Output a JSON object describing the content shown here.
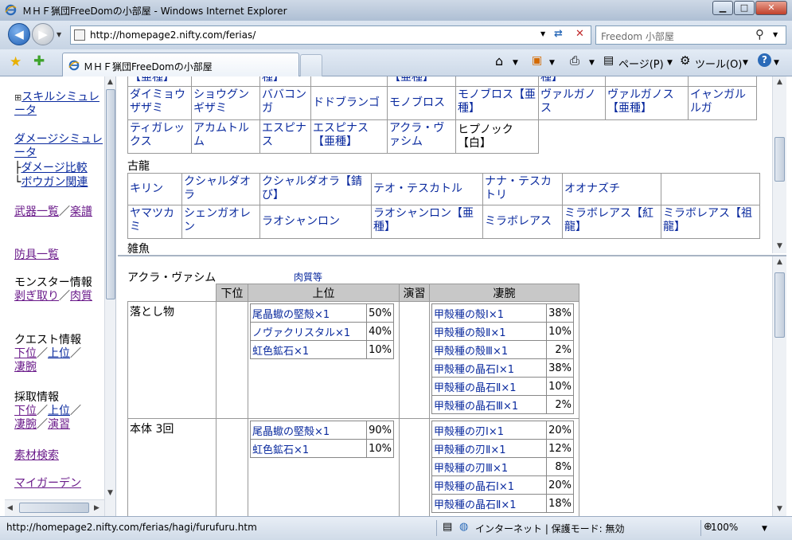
{
  "window": {
    "title": "ＭＨＦ猟団FreeDomの小部屋 - Windows Internet Explorer"
  },
  "nav": {
    "url": "http://homepage2.nifty.com/ferias/",
    "search_placeholder": "Freedom 小部屋"
  },
  "tab": {
    "title": "ＭＨＦ猟団FreeDomの小部屋"
  },
  "toolbar": {
    "page_label": "ページ(P)",
    "tools_label": "ツール(O)"
  },
  "status": {
    "url": "http://homepage2.nifty.com/ferias/hagi/furufuru.htm",
    "zone": "インターネット | 保護モード: 無効",
    "zoom": "100%"
  },
  "sidebar": {
    "skill_sim": "スキルシミュレータ",
    "damage_sim": "ダメージシミュレータ",
    "damage_compare": "ダメージ比較",
    "bowgun": "ボウガン関連",
    "weapons": "武器一覧",
    "score": "楽譜",
    "armor": "防具一覧",
    "monster_info": "モンスター情報",
    "hagitori": "剥ぎ取り",
    "meat": "肉質",
    "quest_info": "クエスト情報",
    "lower": "下位",
    "upper": "上位",
    "sugo": "凄腕",
    "gather_info": "採取情報",
    "practice": "演習",
    "material_search": "素材検索",
    "my_garden": "マイガーデン"
  },
  "monsters": {
    "row_partial": [
      "【亜種】",
      "",
      "種】",
      "",
      "【亜種】",
      "",
      "種】",
      ""
    ],
    "row1": [
      "ダイミョウザザミ",
      "ショウグンギザミ",
      "ババコンガ",
      "ドドブランゴ",
      "モノブロス",
      "モノブロス【亜種】",
      "ヴァルガノス",
      "ヴァルガノス【亜種】",
      "イャンガルルガ"
    ],
    "row2": [
      "ティガレックス",
      "アカムトルム",
      "エスピナス",
      "エスピナス【亜種】",
      "アクラ・ヴァシム",
      "ヒプノック【白】"
    ],
    "elder_label": "古龍",
    "elder_row1": [
      "キリン",
      "クシャルダオラ",
      "クシャルダオラ【錆び】",
      "テオ・テスカトル",
      "ナナ・テスカトリ",
      "オオナズチ"
    ],
    "elder_row2": [
      "ヤマツカミ",
      "シェンガオレン",
      "ラオシャンロン",
      "ラオシャンロン【亜種】",
      "ミラボレアス",
      "ミラボレアス【紅龍】",
      "ミラボレアス【祖龍】"
    ],
    "misc_label": "雑魚"
  },
  "detail": {
    "monster_name": "アクラ・ヴァシム",
    "meat_link": "肉質等",
    "headers": [
      "",
      "下位",
      "上位",
      "演習",
      "凄腕"
    ],
    "drops": {
      "label": "落とし物",
      "upper": [
        {
          "item": "尾晶蠍の堅殻×1",
          "pct": "50%"
        },
        {
          "item": "ノヴァクリスタル×1",
          "pct": "40%"
        },
        {
          "item": "虹色鉱石×1",
          "pct": "10%"
        }
      ],
      "sugo": [
        {
          "item": "甲殻種の殻Ⅰ×1",
          "pct": "38%"
        },
        {
          "item": "甲殻種の殻Ⅱ×1",
          "pct": "10%"
        },
        {
          "item": "甲殻種の殻Ⅲ×1",
          "pct": "2%"
        },
        {
          "item": "甲殻種の晶石Ⅰ×1",
          "pct": "38%"
        },
        {
          "item": "甲殻種の晶石Ⅱ×1",
          "pct": "10%"
        },
        {
          "item": "甲殻種の晶石Ⅲ×1",
          "pct": "2%"
        }
      ]
    },
    "body": {
      "label": "本体 3回",
      "upper": [
        {
          "item": "尾晶蠍の堅殻×1",
          "pct": "90%"
        },
        {
          "item": "虹色鉱石×1",
          "pct": "10%"
        }
      ],
      "sugo": [
        {
          "item": "甲殻種の刃Ⅰ×1",
          "pct": "20%"
        },
        {
          "item": "甲殻種の刃Ⅱ×1",
          "pct": "12%"
        },
        {
          "item": "甲殻種の刃Ⅲ×1",
          "pct": "8%"
        },
        {
          "item": "甲殻種の晶石Ⅰ×1",
          "pct": "20%"
        },
        {
          "item": "甲殻種の晶石Ⅱ×1",
          "pct": "18%"
        }
      ]
    }
  }
}
